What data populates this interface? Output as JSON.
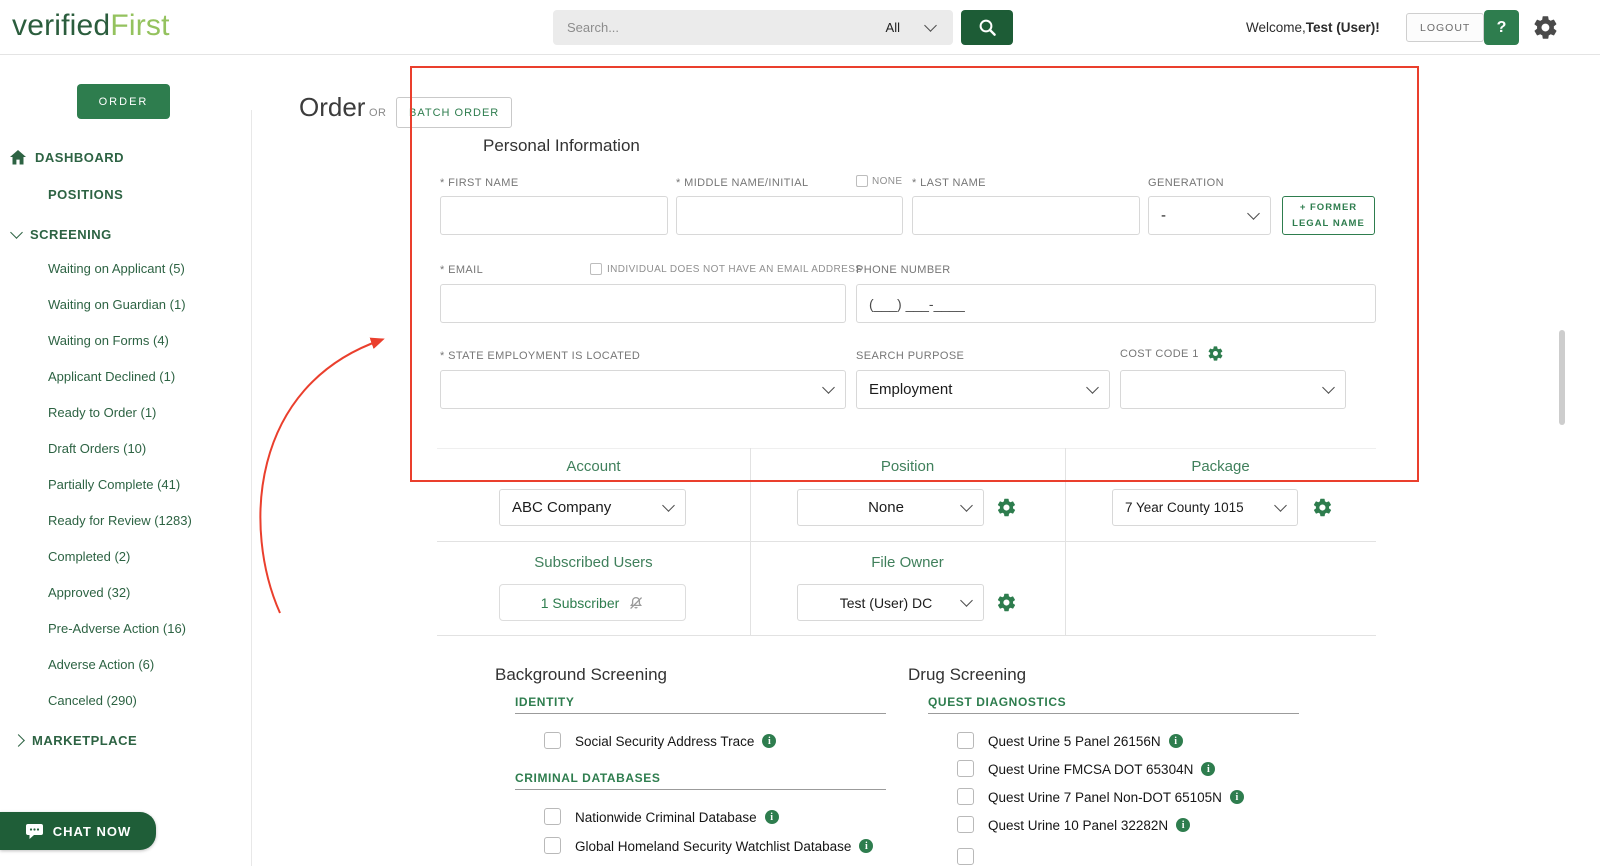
{
  "header": {
    "logo_part1": "verified",
    "logo_part2": "First",
    "search": {
      "placeholder": "Search...",
      "filter_value": "All"
    },
    "welcome_prefix": "Welcome,",
    "welcome_user": "Test (User)!",
    "logout_label": "LOGOUT",
    "help_label": "?"
  },
  "sidebar": {
    "order_button": "ORDER",
    "dashboard": "DASHBOARD",
    "positions": "POSITIONS",
    "screening": "SCREENING",
    "marketplace": "MARKETPLACE",
    "screening_items": [
      "Waiting on Applicant (5)",
      "Waiting on Guardian (1)",
      "Waiting on Forms (4)",
      "Applicant Declined (1)",
      "Ready to Order (1)",
      "Draft Orders (10)",
      "Partially Complete (41)",
      "Ready for Review (1283)",
      "Completed (2)",
      "Approved (32)",
      "Pre-Adverse Action (16)",
      "Adverse Action (6)",
      "Canceled (290)"
    ],
    "chat_button": "CHAT NOW"
  },
  "order_page": {
    "title": "Order",
    "or_text": "OR",
    "batch_order": "BATCH ORDER",
    "personal": {
      "heading": "Personal Information",
      "first_name_label": "* FIRST NAME",
      "middle_name_label": "* MIDDLE NAME/INITIAL",
      "none_label": "NONE",
      "last_name_label": "* LAST NAME",
      "generation_label": "GENERATION",
      "generation_value": "-",
      "former_line1": "+ FORMER",
      "former_line2": "LEGAL NAME",
      "email_label": "* EMAIL",
      "no_email_label": "INDIVIDUAL DOES NOT HAVE AN EMAIL ADDRESS",
      "phone_label": "PHONE NUMBER",
      "phone_mask": "(___) ___-____",
      "state_label": "* STATE EMPLOYMENT IS LOCATED",
      "search_purpose_label": "SEARCH PURPOSE",
      "search_purpose_value": "Employment",
      "cost_code_label": "COST CODE 1"
    },
    "account_section": {
      "account_header": "Account",
      "account_value": "ABC Company",
      "position_header": "Position",
      "position_value": "None",
      "package_header": "Package",
      "package_value": "7 Year County 1015",
      "subscribed_header": "Subscribed Users",
      "subscribed_value": "1 Subscriber",
      "file_owner_header": "File Owner",
      "file_owner_value": "Test (User) DC"
    },
    "background": {
      "heading": "Background Screening",
      "identity_header": "IDENTITY",
      "identity_items": [
        "Social Security Address Trace"
      ],
      "criminal_header": "CRIMINAL DATABASES",
      "criminal_items": [
        "Nationwide Criminal Database",
        "Global Homeland Security Watchlist Database"
      ]
    },
    "drug": {
      "heading": "Drug Screening",
      "quest_header": "QUEST DIAGNOSTICS",
      "quest_items": [
        "Quest Urine 5 Panel 26156N",
        "Quest Urine FMCSA DOT 65304N",
        "Quest Urine 7 Panel Non-DOT 65105N",
        "Quest Urine 10 Panel 32282N"
      ]
    }
  },
  "colors": {
    "brand_green": "#2e7d4e",
    "dark_green": "#1d5c36",
    "light_green": "#94c25e",
    "annotation_red": "#ea3f2d"
  }
}
